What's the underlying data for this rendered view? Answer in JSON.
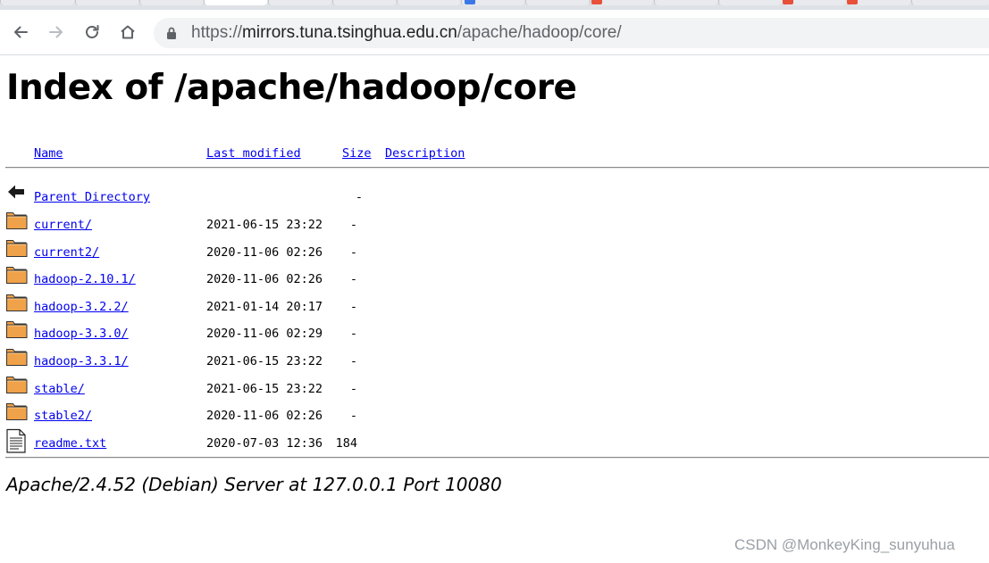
{
  "browser": {
    "url_scheme": "https://",
    "url_host": "mirrors.tuna.tsinghua.edu.cn",
    "url_path": "/apache/hadoop/core/"
  },
  "page": {
    "title": "Index of /apache/hadoop/core",
    "columns": {
      "name": "Name",
      "last_modified": "Last modified",
      "size": "Size",
      "description": "Description"
    },
    "parent": {
      "name": "Parent Directory",
      "size": "-"
    },
    "entries": [
      {
        "name": "current/",
        "modified": "2021-06-15 23:22",
        "size": "-",
        "icon": "folder-icon"
      },
      {
        "name": "current2/",
        "modified": "2020-11-06 02:26",
        "size": "-",
        "icon": "folder-icon"
      },
      {
        "name": "hadoop-2.10.1/",
        "modified": "2020-11-06 02:26",
        "size": "-",
        "icon": "folder-icon"
      },
      {
        "name": "hadoop-3.2.2/",
        "modified": "2021-01-14 20:17",
        "size": "-",
        "icon": "folder-icon"
      },
      {
        "name": "hadoop-3.3.0/",
        "modified": "2020-11-06 02:29",
        "size": "-",
        "icon": "folder-icon"
      },
      {
        "name": "hadoop-3.3.1/",
        "modified": "2021-06-15 23:22",
        "size": "-",
        "icon": "folder-icon"
      },
      {
        "name": "stable/",
        "modified": "2021-06-15 23:22",
        "size": "-",
        "icon": "folder-icon"
      },
      {
        "name": "stable2/",
        "modified": "2020-11-06 02:26",
        "size": "-",
        "icon": "folder-icon"
      },
      {
        "name": "readme.txt",
        "modified": "2020-07-03 12:36",
        "size": "184",
        "icon": "text-file-icon"
      }
    ],
    "server_signature": "Apache/2.4.52 (Debian) Server at 127.0.0.1 Port 10080"
  },
  "watermark": "CSDN @MonkeyKing_sunyuhua",
  "colors": {
    "link": "#0000ee",
    "folder": "#f0a24a"
  }
}
